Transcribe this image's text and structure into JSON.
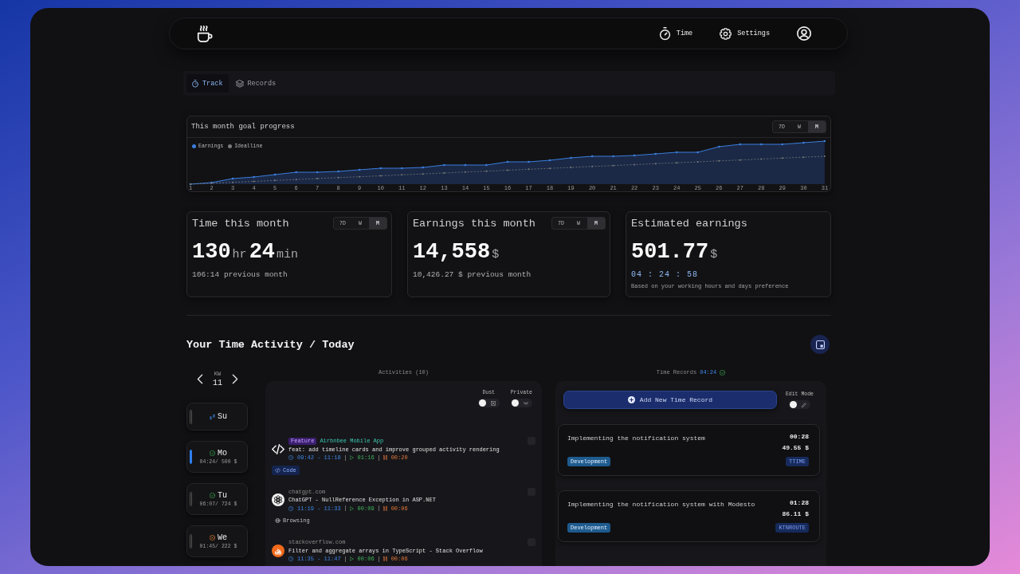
{
  "navbar": {
    "items": [
      {
        "label": "Time",
        "kind": "timer"
      },
      {
        "label": "Settings",
        "kind": "settings"
      }
    ]
  },
  "tabs": [
    {
      "label": "Track",
      "kind": "track",
      "selected": true
    },
    {
      "label": "Records",
      "kind": "records",
      "selected": false
    }
  ],
  "goal_chart": {
    "title": "This month goal progress",
    "ranges": [
      {
        "label": "7D",
        "selected": false
      },
      {
        "label": "W",
        "selected": false
      },
      {
        "label": "M",
        "selected": true
      }
    ],
    "legend": [
      {
        "label": "Earnings",
        "color": "#3b7ddd"
      },
      {
        "label": "Idealline",
        "color": "#7a7a7a"
      }
    ],
    "x_labels": [
      "1",
      "2",
      "3",
      "4",
      "5",
      "6",
      "7",
      "8",
      "9",
      "10",
      "11",
      "12",
      "13",
      "14",
      "15",
      "16",
      "17",
      "18",
      "19",
      "20",
      "21",
      "22",
      "23",
      "24",
      "25",
      "26",
      "27",
      "28",
      "29",
      "30",
      "31"
    ]
  },
  "stats": [
    {
      "title": "Time this month",
      "ranges": [
        {
          "label": "7D",
          "selected": false
        },
        {
          "label": "W",
          "selected": false
        },
        {
          "label": "M",
          "selected": true
        }
      ],
      "value": [
        {
          "text": "130",
          "kind": "number"
        },
        {
          "text": "hr",
          "kind": "unit"
        },
        {
          "text": "24",
          "kind": "number"
        },
        {
          "text": "min",
          "kind": "unit"
        }
      ],
      "note": "106:14 previous month"
    },
    {
      "title": "Earnings this month",
      "ranges": [
        {
          "label": "7D",
          "selected": false
        },
        {
          "label": "W",
          "selected": false
        },
        {
          "label": "M",
          "selected": true
        }
      ],
      "value": [
        {
          "text": "14,558",
          "kind": "number"
        },
        {
          "text": "$",
          "kind": "unit"
        }
      ],
      "note": "10,426.27 $ previous month"
    },
    {
      "title": "Estimated earnings",
      "value": [
        {
          "text": "501.77",
          "kind": "number"
        },
        {
          "text": "$",
          "kind": "unit"
        }
      ],
      "countdown": "04 : 24 : 58",
      "footnote": "Based on your working hours and days preference"
    }
  ],
  "activity_section": {
    "heading": "Your Time Activity / Today",
    "week": {
      "label": "KW",
      "number": "11"
    },
    "days": [
      {
        "label": "Su",
        "kind": "rest",
        "selected": false
      },
      {
        "label": "Mo",
        "kind": "met",
        "note": "04:24/ 500 $",
        "selected": true
      },
      {
        "label": "Tu",
        "kind": "met",
        "note": "06:07/ 724 $",
        "selected": false
      },
      {
        "label": "We",
        "kind": "missed",
        "note": "01:45/ 222 $",
        "selected": false
      }
    ],
    "activities": {
      "title": "Activities (10)",
      "toggles": [
        {
          "label": "Dust",
          "kind": "dust",
          "on": false
        },
        {
          "label": "Private",
          "kind": "private",
          "on": false
        }
      ],
      "items": [
        {
          "kind": "code",
          "tag": "Feature",
          "project": "Airbnbee Mobile App",
          "title": "feat: add timeline cards and improve grouped activity rendering",
          "range": "09:42 - 11:18",
          "active": "01:16",
          "idle": "00:20",
          "category": {
            "label": "Code",
            "kind": "code"
          },
          "checked": false
        },
        {
          "kind": "chat",
          "source": "chatgpt.com",
          "title": "ChatGPT - NullReference Exception in ASP.NET",
          "range": "11:19 - 11:33",
          "active": "00:09",
          "idle": "00:06",
          "category": {
            "label": "Browsing",
            "kind": "browsing"
          },
          "checked": false
        },
        {
          "kind": "qa",
          "source": "stackoverflow.com",
          "title": "Filter and aggregate arrays in TypeScript - Stack Overflow",
          "range": "11:35 - 11:47",
          "active": "00:06",
          "idle": "00:06",
          "checked": false
        }
      ]
    },
    "records": {
      "title": "Time Records",
      "total": "04:24",
      "goal_met": true,
      "add_button": "Add New Time Record",
      "edit_mode": {
        "label": "Edit Mode",
        "on": false
      },
      "items": [
        {
          "title": "Implementing the notification system",
          "duration": "00:28",
          "amount": "49.55 $",
          "category": "Development",
          "project": "TTIME"
        },
        {
          "title": "Implementing the notification system with Modesto",
          "duration": "01:28",
          "amount": "86.11 $",
          "category": "Development",
          "project": "KTNROUTE"
        }
      ]
    }
  }
}
